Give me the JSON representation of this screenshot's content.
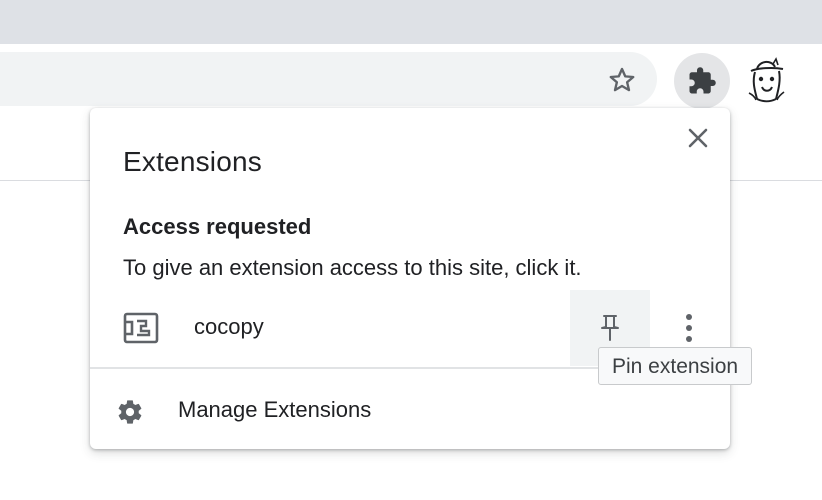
{
  "browser": {
    "toolbar": {
      "bookmark_icon": "star-outline-icon",
      "extensions_icon": "puzzle-piece-icon",
      "profile_icon": "profile-avatar-icon",
      "extensions_button_bg": "#e4e5e7"
    }
  },
  "popup": {
    "title": "Extensions",
    "close_icon": "close-icon",
    "access_section": {
      "heading": "Access requested",
      "description": "To give an extension access to this site, click it."
    },
    "extensions": [
      {
        "name": "cocopy",
        "icon": "extension-placeholder-icon",
        "pin_icon": "pin-icon",
        "more_icon": "more-vertical-icon"
      }
    ],
    "manage": {
      "label": "Manage Extensions",
      "icon": "gear-icon"
    }
  },
  "tooltip": {
    "text": "Pin extension"
  },
  "colors": {
    "tabstrip": "#dee1e6",
    "omnibox": "#f1f3f4",
    "icon_gray": "#5f6368",
    "text": "#202124",
    "pin_hover": "#f1f3f4"
  }
}
